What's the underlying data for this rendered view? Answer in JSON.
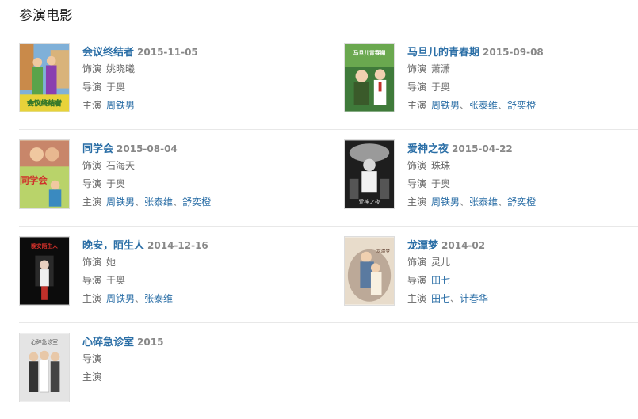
{
  "section": {
    "title": "参演电影"
  },
  "labels": {
    "role": "饰演",
    "director": "导演",
    "cast": "主演"
  },
  "movies": [
    {
      "title": "会议终结者",
      "date": "2015-11-05",
      "role": "姚晓曦",
      "director": "于奥",
      "cast": [
        "周铁男"
      ],
      "poster_text": "会议终结者"
    },
    {
      "title": "马旦儿的青春期",
      "date": "2015-09-08",
      "role": "萧潇",
      "director": "于奥",
      "cast": [
        "周铁男",
        "张泰维",
        "舒奕橙"
      ],
      "poster_text": "马旦儿青春期"
    },
    {
      "title": "同学会",
      "date": "2015-08-04",
      "role": "石海天",
      "director": "于奥",
      "cast": [
        "周铁男",
        "张泰维",
        "舒奕橙"
      ],
      "poster_text": "同学会"
    },
    {
      "title": "爱神之夜",
      "date": "2015-04-22",
      "role": "珠珠",
      "director": "于奥",
      "cast": [
        "周铁男",
        "张泰维",
        "舒奕橙"
      ],
      "poster_text": "爱神之夜"
    },
    {
      "title": "晚安，陌生人",
      "date": "2014-12-16",
      "role": "她",
      "director": "于奥",
      "cast": [
        "周铁男",
        "张泰维"
      ],
      "poster_text": "晚安陌生人"
    },
    {
      "title": "龙潭梦",
      "date": "2014-02",
      "role": "灵儿",
      "director": "田七",
      "cast": [
        "田七",
        "计春华"
      ],
      "poster_text": "龙潭梦"
    },
    {
      "title": "心碎急诊室",
      "date": "2015",
      "role": "",
      "director": "",
      "cast": [],
      "poster_text": "心碎急诊室"
    }
  ],
  "colors": {
    "link": "#2a6ea6",
    "muted": "#888888",
    "divider": "#e8e8e8"
  }
}
